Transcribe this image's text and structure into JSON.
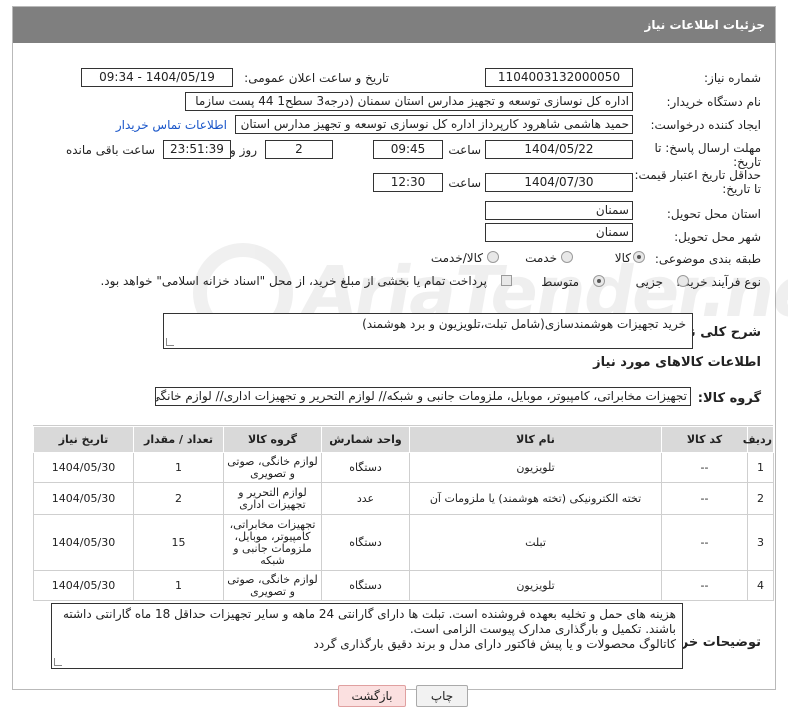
{
  "header": {
    "title": "جزئیات اطلاعات نیاز"
  },
  "watermark": {
    "text": "AriaTender.net"
  },
  "fields": {
    "need_number": {
      "label": "شماره نیاز:",
      "value": "1104003132000050"
    },
    "announce_datetime": {
      "label": "تاریخ و ساعت اعلان عمومی:",
      "value": "1404/05/19 - 09:34"
    },
    "buyer_org": {
      "label": "نام دستگاه خریدار:",
      "value": "اداره کل نوسازی   توسعه و تجهیز مدارس استان سمنان (درجه3  سطح1  44 پست سازما"
    },
    "requester": {
      "label": "ایجاد کننده درخواست:",
      "value": "حمید هاشمی شاهرود کارپرداز اداره کل نوسازی   توسعه و تجهیز مدارس استان"
    },
    "contact_link": "اطلاعات تماس خریدار",
    "reply_deadline": {
      "label_line1": "مهلت ارسال پاسخ: تا",
      "label_line2": "تاریخ:",
      "date": "1404/05/22",
      "time_label": "ساعت",
      "time": "09:45",
      "days": "2",
      "days_label": "روز و",
      "remaining": "23:51:39",
      "remaining_label": "ساعت باقی مانده"
    },
    "price_validity": {
      "label_line1": "حداقل تاریخ اعتبار قیمت:",
      "label_line2": "تا تاریخ:",
      "date": "1404/07/30",
      "time_label": "ساعت",
      "time": "12:30"
    },
    "province": {
      "label": "استان محل تحویل:",
      "value": "سمنان"
    },
    "city": {
      "label": "شهر محل تحویل:",
      "value": "سمنان"
    },
    "category": {
      "label": "طبقه بندی موضوعی:",
      "options": [
        "کالا",
        "خدمت",
        "کالا/خدمت"
      ],
      "selected": "کالا"
    },
    "process_type": {
      "label": "نوع فرآیند خرید :",
      "options": [
        "جزیی",
        "متوسط"
      ],
      "selected": "متوسط",
      "payment_note": "پرداخت تمام یا بخشی از مبلغ خرید، از محل \"اسناد خزانه اسلامی\" خواهد بود."
    }
  },
  "description": {
    "label": "شرح کلی نیاز:",
    "value": "خرید تجهیزات هوشمندسازی(شامل تبلت،تلویزیون و برد هوشمند)"
  },
  "goods_section": {
    "title": "اطلاعات کالاهای مورد نیاز"
  },
  "goods_group": {
    "label": "گروه کالا:",
    "value": "تجهیزات مخابراتی، کامپیوتر، موبایل، ملزومات جانبی و شبکه// لوازم التحریر و تجهیزات اداری// لوازم خانگی، ص"
  },
  "table": {
    "headers": [
      "ردیف",
      "کد کالا",
      "نام کالا",
      "واحد شمارش",
      "گروه کالا",
      "تعداد / مقدار",
      "تاریخ نیاز"
    ],
    "rows": [
      [
        "1",
        "--",
        "تلویزیون",
        "دستگاه",
        "لوازم خانگی، صوتی و تصویری",
        "1",
        "1404/05/30"
      ],
      [
        "2",
        "--",
        "تخته الکترونیکی (تخته هوشمند) یا ملزومات آن",
        "عدد",
        "لوازم التحریر و تجهیزات اداری",
        "2",
        "1404/05/30"
      ],
      [
        "3",
        "--",
        "تبلت",
        "دستگاه",
        "تجهیزات مخابراتی، کامپیوتر، موبایل، ملزومات جانبی و شبکه",
        "15",
        "1404/05/30"
      ],
      [
        "4",
        "--",
        "تلویزیون",
        "دستگاه",
        "لوازم خانگی، صوتی و تصویری",
        "1",
        "1404/05/30"
      ]
    ]
  },
  "buyer_notes": {
    "label": "توضیحات خریدار:",
    "lines": [
      "هزینه های حمل و تخلیه بعهده فروشنده است. تبلت ها دارای گارانتی 24 ماهه و سایر تجهیزات حداقل 18 ماه گارانتی داشته باشند. تکمیل و بارگذاری مدارک پیوست الزامی است.",
      "کاتالوگ محصولات و یا پیش فاکتور دارای مدل و برند دقیق بارگذاری گردد"
    ]
  },
  "buttons": {
    "print": "چاپ",
    "back": "بازگشت"
  }
}
